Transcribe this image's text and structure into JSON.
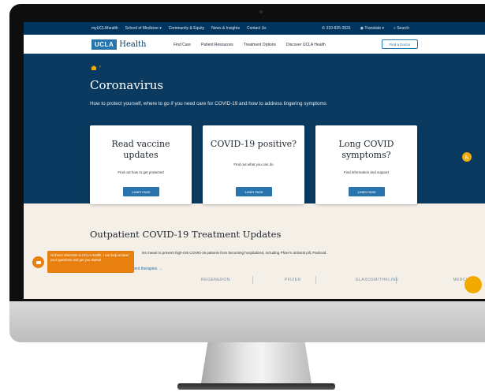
{
  "utility_bar": {
    "left_links": [
      "myUCLAhealth",
      "School of Medicine ▾",
      "Community & Equity",
      "News & Insights",
      "Contact Us"
    ],
    "phone": "310-825-2631",
    "translate": "Translate ▾",
    "search": "Search"
  },
  "nav": {
    "logo_box": "UCLA",
    "logo_text": "Health",
    "links": [
      "Find Care",
      "Patient Resources",
      "Treatment Options",
      "Discover UCLA Health"
    ],
    "find_doctor": "Find a Doctor"
  },
  "hero": {
    "title": "Coronavirus",
    "subtitle": "How to protect yourself, where to go if you need care for COVID-19 and how to address lingering symptoms"
  },
  "cards": [
    {
      "title": "Read vaccine updates",
      "text": "Find out how to get protected",
      "button": "Learn more"
    },
    {
      "title": "COVID-19 positive?",
      "text": "Find out what you can do",
      "button": "Learn more"
    },
    {
      "title": "Long COVID symptoms?",
      "text": "Find information and support",
      "button": "Learn more"
    }
  ],
  "section": {
    "title": "Outpatient COVID-19 Treatment Updates",
    "text": "ies meant to prevent high-risk COVID-19 patients from becoming hospitalized, including Pfizer's antiviral pill, Paxlovid.",
    "link": "tient therapies →"
  },
  "logo_strip": [
    "REGENERON",
    "PFIZER",
    "GLAXOSMITHKLINE",
    "MERCK"
  ],
  "chat": {
    "message": "Hi there! Welcome to UCLA Health. I can help answer your questions and get you started."
  },
  "colors": {
    "navy": "#00355f",
    "hero": "#0a3a5f",
    "blue": "#2774ae",
    "gold": "#f2a900",
    "chat_orange": "#e8800f"
  }
}
